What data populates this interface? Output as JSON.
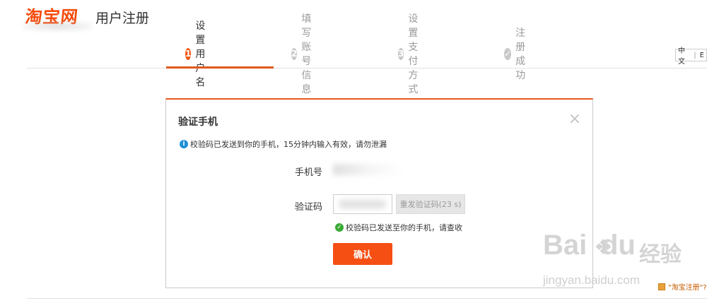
{
  "header": {
    "logo_text": "淘宝网",
    "page_title": "用户注册"
  },
  "steps": [
    {
      "num": "1",
      "label": "设置用户名",
      "active": true
    },
    {
      "num": "2",
      "label": "填写账号信息",
      "active": false
    },
    {
      "num": "3",
      "label": "设置支付方式",
      "active": false
    },
    {
      "num": "✓",
      "label": "注册成功",
      "active": false
    }
  ],
  "lang": {
    "cn": "中文",
    "en": "E"
  },
  "modal": {
    "title": "验证手机",
    "close_glyph": "×",
    "info": "校验码已发送到你的手机，15分钟内输入有效，请勿泄漏",
    "phone_label": "手机号",
    "code_label": "验证码",
    "resend_label": "重发验证码(23 s)",
    "sent_note": "校验码已发送至你的手机，请查收",
    "confirm_label": "确认"
  },
  "watermark": {
    "brand": "Bai",
    "brand2": "du",
    "cn": "经验",
    "url": "jingyan.baidu.com"
  },
  "feedback": "\"淘宝注册\"?"
}
